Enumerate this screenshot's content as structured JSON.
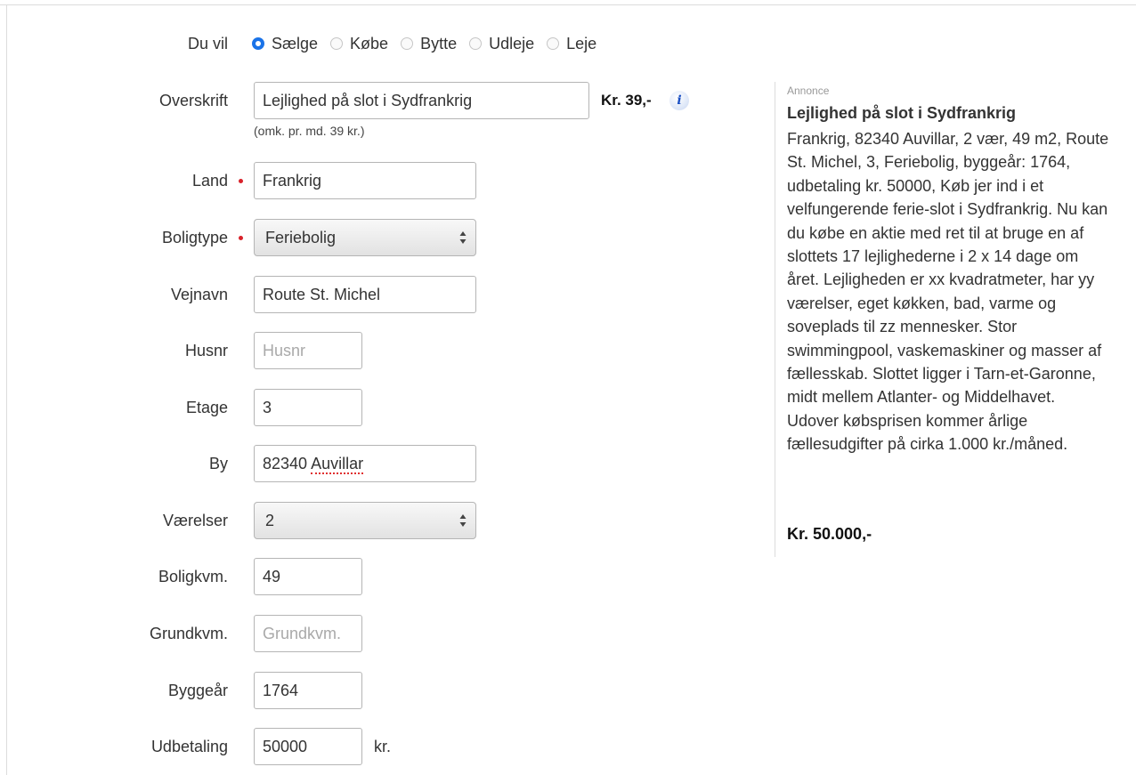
{
  "form": {
    "du_vil": {
      "label": "Du vil",
      "options": [
        "Sælge",
        "Købe",
        "Bytte",
        "Udleje",
        "Leje"
      ],
      "selected": "Sælge"
    },
    "overskrift": {
      "label": "Overskrift",
      "value": "Lejlighed på slot i Sydfrankrig",
      "price": "Kr. 39,-",
      "info_icon": "i",
      "hint": "(omk. pr. md. 39 kr.)"
    },
    "land": {
      "label": "Land",
      "value": "Frankrig",
      "required": true
    },
    "boligtype": {
      "label": "Boligtype",
      "value": "Feriebolig",
      "required": true
    },
    "vejnavn": {
      "label": "Vejnavn",
      "value": "Route St. Michel"
    },
    "husnr": {
      "label": "Husnr",
      "placeholder": "Husnr"
    },
    "etage": {
      "label": "Etage",
      "value": "3"
    },
    "by": {
      "label": "By",
      "value_zip": "82340",
      "value_city": "Auvillar"
    },
    "vaerelser": {
      "label": "Værelser",
      "value": "2"
    },
    "boligkvm": {
      "label": "Boligkvm.",
      "value": "49"
    },
    "grundkvm": {
      "label": "Grundkvm.",
      "placeholder": "Grundkvm."
    },
    "byggeaar": {
      "label": "Byggeår",
      "value": "1764"
    },
    "udbetaling": {
      "label": "Udbetaling",
      "value": "50000",
      "suffix": "kr."
    }
  },
  "ad_preview": {
    "label": "Annonce",
    "title": "Lejlighed på slot i Sydfrankrig",
    "body": "Frankrig, 82340 Auvillar, 2 vær, 49 m2, Route St. Michel, 3, Feriebolig, byggeår: 1764, udbetaling kr. 50000, Køb jer ind i et velfungerende ferie-slot i Sydfrankrig. Nu kan du købe en aktie med ret til at bruge en af slottets 17 lejlighederne i 2 x 14 dage om året. Lejligheden er xx kvadratmeter, har yy værelser, eget køkken, bad, varme og soveplads til zz mennesker. Stor swimmingpool, vaskemaskiner og masser af fællesskab. Slottet ligger i Tarn-et-Garonne, midt mellem Atlanter- og Middelhavet. Udover købsprisen kommer årlige fællesudgifter på cirka 1.000 kr./måned.",
    "price": "Kr. 50.000,-"
  },
  "colors": {
    "accent": "#1a73e8",
    "required": "#d9222a",
    "border": "#b5b5b5"
  }
}
